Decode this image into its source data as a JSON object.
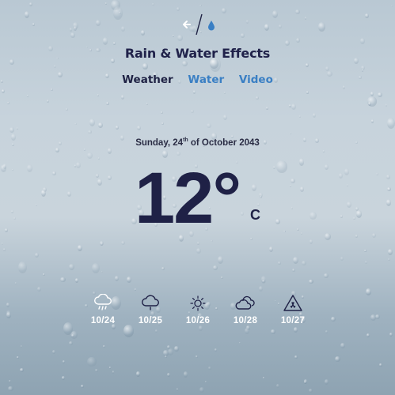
{
  "header": {
    "title": "Rain & Water Effects",
    "logo_icon": "arrow-slash-drop-logo"
  },
  "nav": {
    "items": [
      {
        "label": "Weather",
        "active": true
      },
      {
        "label": "Water",
        "active": false
      },
      {
        "label": "Video",
        "active": false
      }
    ]
  },
  "weather": {
    "date_prefix": "Sunday, 24",
    "date_suffix": "th",
    "date_rest": " of October 2043",
    "temperature": "12°",
    "unit": "C"
  },
  "forecast": [
    {
      "date": "10/24",
      "icon": "rain-cloud-icon"
    },
    {
      "date": "10/25",
      "icon": "cloud-icon"
    },
    {
      "date": "10/26",
      "icon": "sun-icon"
    },
    {
      "date": "10/28",
      "icon": "cloudy-icon"
    },
    {
      "date": "10/27",
      "icon": "hazard-icon"
    }
  ],
  "colors": {
    "title": "#20224a",
    "nav_active": "#1f2244",
    "nav_link": "#3a7fc4",
    "temp": "#1f2146"
  }
}
